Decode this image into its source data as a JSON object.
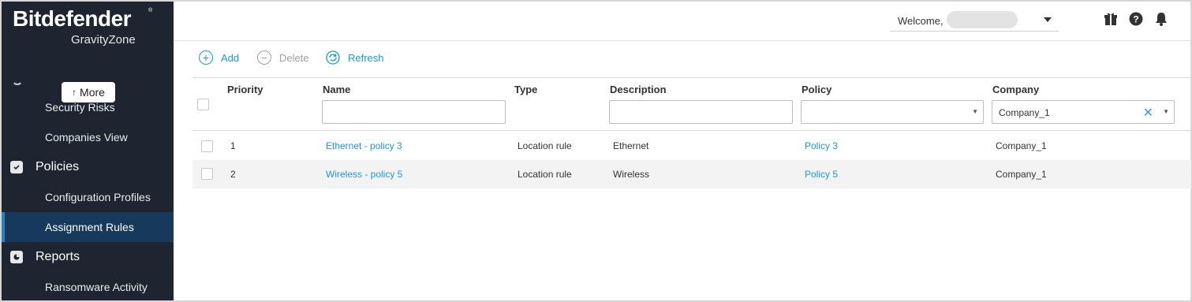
{
  "sidebar": {
    "logo_main": "Bitdefender",
    "logo_reg": "®",
    "logo_sub": "GravityZone",
    "collapse_glyph": "‹",
    "more_label": "More",
    "more_arrow": "↑",
    "items": [
      {
        "label": "Security Risks",
        "type": "sub"
      },
      {
        "label": "Companies View",
        "type": "sub"
      },
      {
        "label": "Policies",
        "type": "section",
        "icon": "policies-icon"
      },
      {
        "label": "Configuration Profiles",
        "type": "sub"
      },
      {
        "label": "Assignment Rules",
        "type": "sub",
        "active": true
      },
      {
        "label": "Reports",
        "type": "section",
        "icon": "reports-icon"
      },
      {
        "label": "Ransomware Activity",
        "type": "sub"
      }
    ]
  },
  "header": {
    "welcome_label": "Welcome,",
    "icons": [
      "gift-icon",
      "help-icon",
      "bell-icon"
    ]
  },
  "toolbar": {
    "add_label": "Add",
    "delete_label": "Delete",
    "refresh_label": "Refresh"
  },
  "table": {
    "columns": [
      "Priority",
      "Name",
      "Type",
      "Description",
      "Policy",
      "Company"
    ],
    "filters": {
      "name": "",
      "description": "",
      "policy": "",
      "company": "Company_1"
    },
    "rows": [
      {
        "priority": "1",
        "name": "Ethernet - policy 3",
        "type": "Location rule",
        "description": "Ethernet",
        "policy": "Policy 3",
        "company": "Company_1"
      },
      {
        "priority": "2",
        "name": "Wireless - policy 5",
        "type": "Location rule",
        "description": "Wireless",
        "policy": "Policy 5",
        "company": "Company_1"
      }
    ]
  },
  "colors": {
    "sidebar_bg": "#1e2530",
    "active_bg": "#173a5c",
    "accent": "#1a9ad6"
  }
}
